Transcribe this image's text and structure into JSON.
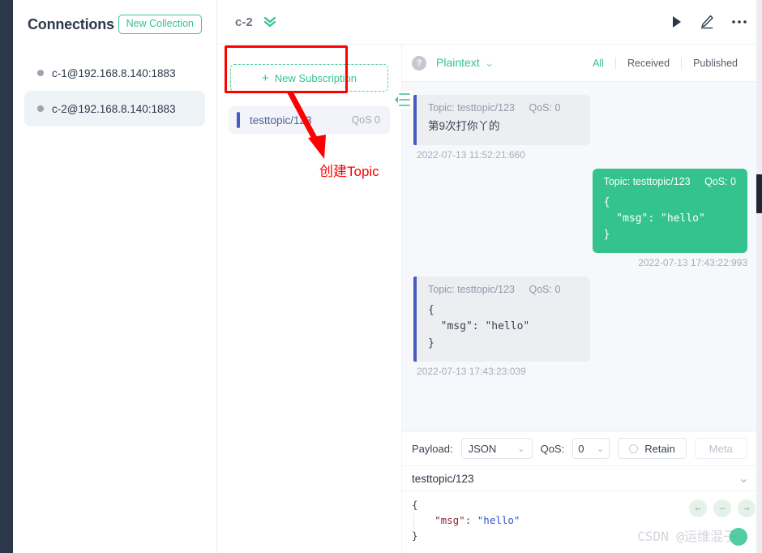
{
  "sidebar": {
    "title": "Connections",
    "new_collection_label": "New Collection",
    "items": [
      {
        "label": "c-1@192.168.8.140:1883",
        "active": false
      },
      {
        "label": "c-2@192.168.8.140:1883",
        "active": true
      }
    ]
  },
  "header": {
    "connection_name": "c-2",
    "icons": [
      "chevron-double-down-icon",
      "play-icon",
      "pencil-icon",
      "more-horizontal-icon"
    ]
  },
  "subscriptions": {
    "new_subscription_label": "New Subscription",
    "plus": "+",
    "collapse_icon": "menu-fold-icon",
    "items": [
      {
        "topic": "testtopic/123",
        "qos": "QoS 0"
      }
    ]
  },
  "messages_toolbar": {
    "help_icon_label": "?",
    "payload_format": "Plaintext",
    "chevron": "⌄",
    "filters": [
      {
        "label": "All",
        "active": true
      },
      {
        "label": "Received",
        "active": false
      },
      {
        "label": "Published",
        "active": false
      }
    ]
  },
  "messages": [
    {
      "direction": "in",
      "topic_label": "Topic: testtopic/123",
      "qos_label": "QoS: 0",
      "payload": "第9次打你丫的",
      "payload_kind": "plain",
      "timestamp": "2022-07-13 11:52:21:660"
    },
    {
      "direction": "out",
      "topic_label": "Topic: testtopic/123",
      "qos_label": "QoS: 0",
      "payload": "{\n  \"msg\": \"hello\"\n}",
      "payload_kind": "json",
      "timestamp": "2022-07-13 17:43:22:993"
    },
    {
      "direction": "in",
      "topic_label": "Topic: testtopic/123",
      "qos_label": "QoS: 0",
      "payload": "{\n  \"msg\": \"hello\"\n}",
      "payload_kind": "json",
      "timestamp": "2022-07-13 17:43:23:039"
    }
  ],
  "publish": {
    "payload_label": "Payload:",
    "payload_value": "JSON",
    "qos_label": "QoS:",
    "qos_value": "0",
    "retain_label": "Retain",
    "meta_label": "Meta",
    "topic_value": "testtopic/123",
    "editor": {
      "line1": "{",
      "line2_key": "\"msg\"",
      "line2_sep": ": ",
      "line2_val": "\"hello\"",
      "line3": "}"
    },
    "buttons": [
      "arrow-left-icon",
      "minus-icon",
      "arrow-right-icon"
    ]
  },
  "watermark": "CSDN @运维混子",
  "annotations": {
    "text": "创建Topic",
    "rect_name": "new-subscription-highlight",
    "arrow_name": "annotation-arrow"
  },
  "colors": {
    "accent_green": "#34c38f",
    "annotation_red": "#fe0000",
    "sub_bar_blue": "#4a5bbf",
    "rail_dark": "#2c3849"
  }
}
